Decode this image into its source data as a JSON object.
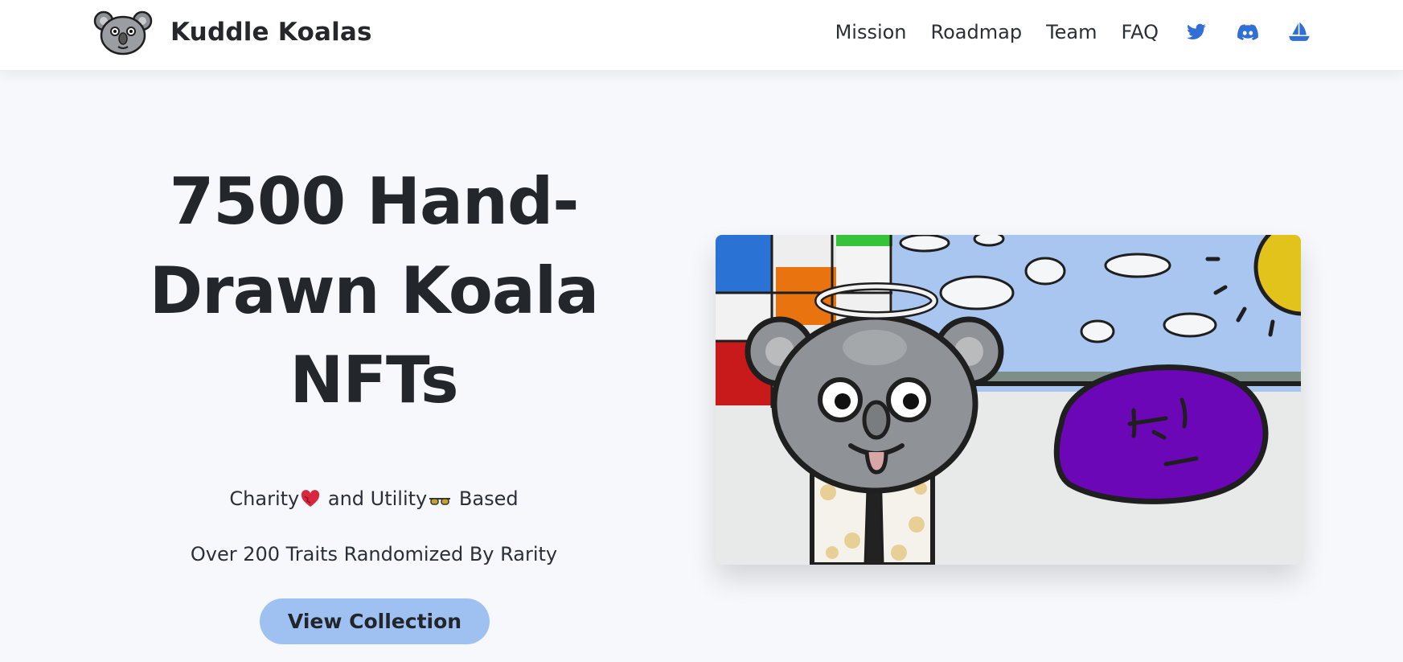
{
  "brand": {
    "name": "Kuddle Koalas",
    "logo_icon": "koala-head-icon"
  },
  "nav": {
    "links": [
      {
        "label": "Mission"
      },
      {
        "label": "Roadmap"
      },
      {
        "label": "Team"
      },
      {
        "label": "FAQ"
      }
    ],
    "icons": [
      "twitter-icon",
      "discord-icon",
      "opensea-icon"
    ],
    "icon_color": "#2f6fd6"
  },
  "hero": {
    "title_lines": [
      "7500 Hand-",
      "Drawn Koala",
      "NFTs"
    ],
    "tagline": {
      "part1": "Charity",
      "part2": " and Utility",
      "part3": " Based"
    },
    "tagline_icons": [
      "heart-icon",
      "sunglasses-icon"
    ],
    "traits_text": "Over 200 Traits Randomized By Rarity",
    "cta_label": "View Collection",
    "cta_color": "#9fc1f2",
    "image_icon": "koala-nft-illustration"
  },
  "colors": {
    "background": "#f6f8fb",
    "navbar": "#ffffff",
    "text": "#23262b"
  }
}
